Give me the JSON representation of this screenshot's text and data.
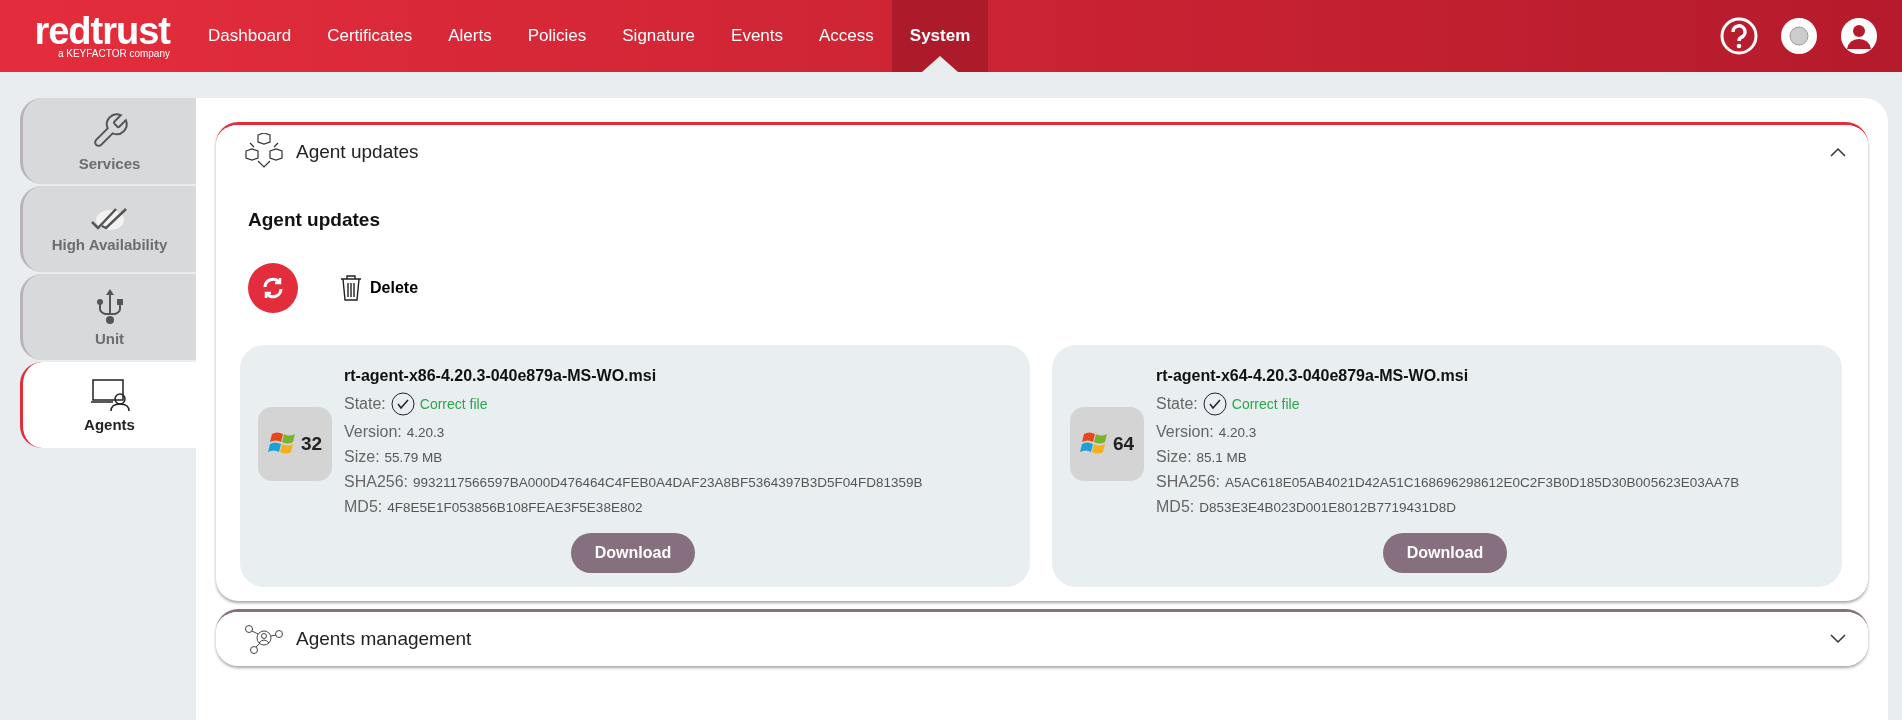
{
  "logo": {
    "name": "redtrust",
    "tagline": "a KEYFACTOR company"
  },
  "nav": [
    {
      "label": "Dashboard",
      "selected": false
    },
    {
      "label": "Certificates",
      "selected": false
    },
    {
      "label": "Alerts",
      "selected": false
    },
    {
      "label": "Policies",
      "selected": false
    },
    {
      "label": "Signature",
      "selected": false
    },
    {
      "label": "Events",
      "selected": false
    },
    {
      "label": "Access",
      "selected": false
    },
    {
      "label": "System",
      "selected": true
    }
  ],
  "sidebar": {
    "items": [
      {
        "label": "Services",
        "kind": "wrench",
        "selected": false
      },
      {
        "label": "High Availability",
        "kind": "checks",
        "selected": false
      },
      {
        "label": "Unit",
        "kind": "usb",
        "selected": false
      },
      {
        "label": "Agents",
        "kind": "agent",
        "selected": true
      }
    ]
  },
  "sections": [
    {
      "title": "Agent updates",
      "kind": "cubes",
      "expanded": true,
      "heading": "Agent updates",
      "delete_label": "Delete",
      "files": [
        {
          "arch": "32",
          "name": "rt-agent-x86-4.20.3-040e879a-MS-WO.msi",
          "state_label": "State:",
          "state": "Correct file",
          "version_label": "Version:",
          "version": "4.20.3",
          "size_label": "Size:",
          "size": "55.79 MB",
          "sha_label": "SHA256:",
          "sha": "9932117566597BA000D476464C4FEB0A4DAF23A8BF5364397B3D5F04FD81359B",
          "md5_label": "MD5:",
          "md5": "4F8E5E1F053856B108FEAE3F5E38E802",
          "button": "Download"
        },
        {
          "arch": "64",
          "name": "rt-agent-x64-4.20.3-040e879a-MS-WO.msi",
          "state_label": "State:",
          "state": "Correct file",
          "version_label": "Version:",
          "version": "4.20.3",
          "size_label": "Size:",
          "size": "85.1 MB",
          "sha_label": "SHA256:",
          "sha": "A5AC618E05AB4021D42A51C168696298612E0C2F3B0D185D30B005623E03AA7B",
          "md5_label": "MD5:",
          "md5": "D853E3E4B023D001E8012B7719431D8D",
          "button": "Download"
        }
      ]
    },
    {
      "title": "Agents management",
      "kind": "network",
      "expanded": false
    }
  ]
}
